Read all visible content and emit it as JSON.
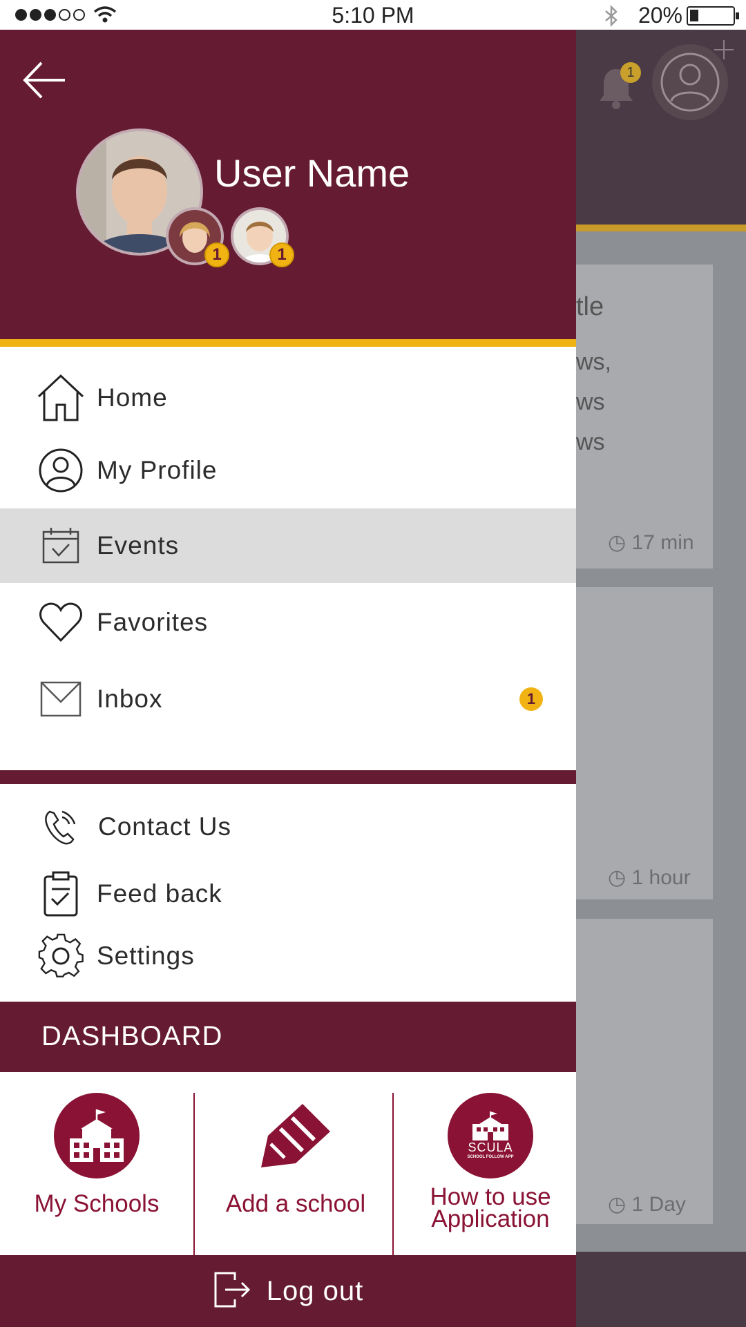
{
  "status_bar": {
    "time": "5:10 PM",
    "battery": "20%"
  },
  "background_feed": {
    "card1_title_fragment": "tle",
    "card1_lines": [
      "ws,",
      "ws",
      "ws"
    ],
    "card1_time": "17 min",
    "card2_time": "1 hour",
    "card3_time": "1 Day",
    "bell_badge": "1"
  },
  "drawer": {
    "user_name": "User Name",
    "child_badges": [
      "1",
      "1"
    ],
    "menu": [
      {
        "label": "Home",
        "icon": "home-icon"
      },
      {
        "label": "My Profile",
        "icon": "user-icon"
      },
      {
        "label": "Events",
        "icon": "calendar-check-icon",
        "active": true
      },
      {
        "label": "Favorites",
        "icon": "heart-icon"
      },
      {
        "label": "Inbox",
        "icon": "mail-icon",
        "badge": "1"
      }
    ],
    "secondary_menu": [
      {
        "label": "Contact Us",
        "icon": "phone-icon"
      },
      {
        "label": "Feed back",
        "icon": "clipboard-check-icon"
      },
      {
        "label": "Settings",
        "icon": "gear-icon"
      }
    ],
    "dashboard": {
      "title": "DASHBOARD",
      "items": [
        {
          "label": "My Schools",
          "icon": "school-icon"
        },
        {
          "label": "Add a school",
          "icon": "pencil-icon"
        },
        {
          "label_line1": "How to use",
          "label_line2": "Application",
          "icon": "scula-logo-icon",
          "logo_text": "SCULA",
          "logo_subtext": "SCHOOL FOLLOW APP"
        }
      ]
    },
    "logout_label": "Log out"
  },
  "colors": {
    "primary": "#651b31",
    "accent": "#f1b314",
    "dashboard_red": "#8a1234"
  }
}
